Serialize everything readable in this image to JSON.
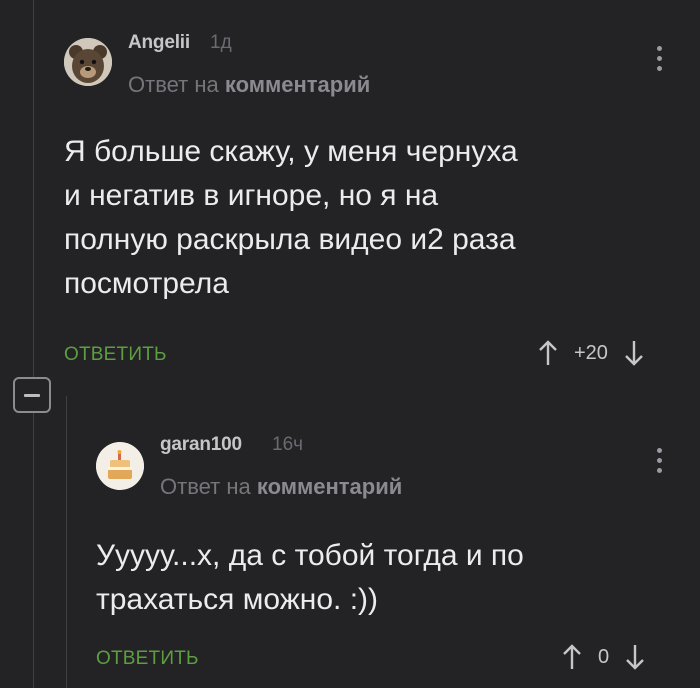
{
  "comment1": {
    "username": "Angelii",
    "time": "1д",
    "reply_prefix": "Ответ на",
    "reply_target": "комментарий",
    "text_lines": [
      "Я  больше скажу, у меня чернуха",
      "и негатив в игноре, но я на",
      "полную раскрыла видео и2 раза",
      "посмотрела"
    ],
    "reply_label": "ОТВЕТИТЬ",
    "rating": "+20",
    "avatar": "bear-avatar-icon"
  },
  "comment2": {
    "username": "garan100",
    "time": "16ч",
    "reply_prefix": "Ответ на",
    "reply_target": "комментарий",
    "text_lines": [
      "Ууууу...х, да с тобой тогда и по",
      "трахаться можно. :))"
    ],
    "reply_label": "ОТВЕТИТЬ",
    "rating": "0",
    "avatar": "cake-avatar-icon"
  },
  "colors": {
    "background": "#232326",
    "accent_green": "#5c9e40",
    "text": "#ececec",
    "muted": "#75757b"
  }
}
